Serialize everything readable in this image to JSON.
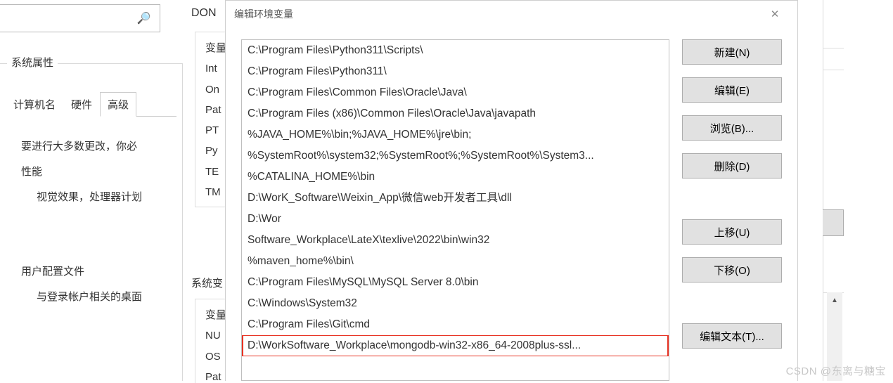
{
  "bg": {
    "don_label": "DON",
    "sysprops_title": "系统属性",
    "tabs": [
      "计算机名",
      "硬件",
      "高级"
    ],
    "body_line1": "要进行大多数更改，你必",
    "perf_heading": "性能",
    "perf_desc": "视觉效果，处理器计划",
    "profiles_heading": "用户配置文件",
    "profiles_desc": "与登录帐户相关的桌面",
    "varbox1": [
      "变量",
      "Int",
      "On",
      "Pat",
      "PT",
      "Py",
      "TE",
      "TM"
    ],
    "sysvar_label": "系统变",
    "varbox2": [
      "变量",
      "NU",
      "OS",
      "Pat"
    ]
  },
  "dialog": {
    "title": "编辑环境变量",
    "paths": [
      "C:\\Program Files\\Python311\\Scripts\\",
      "C:\\Program Files\\Python311\\",
      "C:\\Program Files\\Common Files\\Oracle\\Java\\",
      "C:\\Program Files (x86)\\Common Files\\Oracle\\Java\\javapath",
      "%JAVA_HOME%\\bin;%JAVA_HOME%\\jre\\bin;",
      "%SystemRoot%\\system32;%SystemRoot%;%SystemRoot%\\System3...",
      "%CATALINA_HOME%\\bin",
      "D:\\WorK_Software\\Weixin_App\\微信web开发者工具\\dll",
      "D:\\Wor",
      "Software_Workplace\\LateX\\texlive\\2022\\bin\\win32",
      "%maven_home%\\bin\\",
      "C:\\Program Files\\MySQL\\MySQL Server 8.0\\bin",
      "C:\\Windows\\System32",
      "C:\\Program Files\\Git\\cmd",
      "D:\\WorkSoftware_Workplace\\mongodb-win32-x86_64-2008plus-ssl..."
    ],
    "highlight_index": 14,
    "buttons": {
      "new": "新建(N)",
      "edit": "编辑(E)",
      "browse": "浏览(B)...",
      "delete": "删除(D)",
      "moveup": "上移(U)",
      "movedown": "下移(O)",
      "edittext": "编辑文本(T)..."
    }
  },
  "watermark": "CSDN @东离与糖宝"
}
